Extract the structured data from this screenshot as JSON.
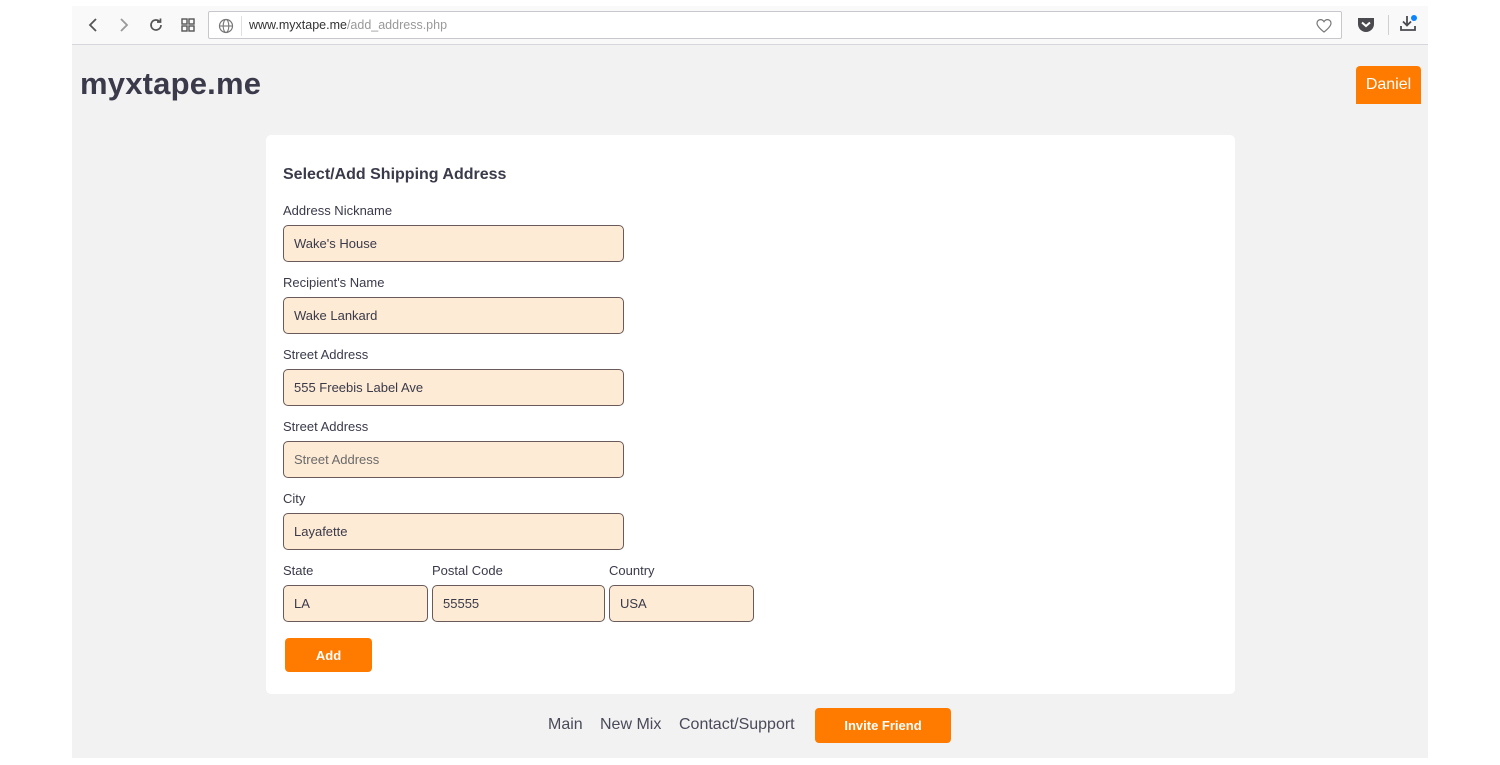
{
  "browser": {
    "url_domain": "www.myxtape.me",
    "url_path": "/add_address.php",
    "icons": {
      "back": "chevron-left-icon",
      "forward": "chevron-right-icon",
      "reload": "reload-icon",
      "speed_dial": "grid-icon",
      "site_info": "globe-icon",
      "bookmark": "heart-icon",
      "pocket": "pocket-icon",
      "download": "download-icon"
    }
  },
  "header": {
    "logo": "myxtape.me",
    "user_name": "Daniel"
  },
  "form": {
    "title": "Select/Add Shipping Address",
    "nickname": {
      "label": "Address Nickname",
      "value": "Wake's House",
      "placeholder": ""
    },
    "recipient": {
      "label": "Recipient's Name",
      "value": "Wake Lankard",
      "placeholder": ""
    },
    "street1": {
      "label": "Street Address",
      "value": "555 Freebis Label Ave",
      "placeholder": ""
    },
    "street2": {
      "label": "Street Address",
      "value": "",
      "placeholder": "Street Address"
    },
    "city": {
      "label": "City",
      "value": "Layafette",
      "placeholder": ""
    },
    "state": {
      "label": "State",
      "value": "LA",
      "placeholder": ""
    },
    "postal": {
      "label": "Postal Code",
      "value": "55555",
      "placeholder": ""
    },
    "country": {
      "label": "Country",
      "value": "USA",
      "placeholder": ""
    },
    "add_label": "Add"
  },
  "footer": {
    "links": [
      "Main",
      "New Mix",
      "Contact/Support"
    ],
    "invite_label": "Invite Friend"
  },
  "colors": {
    "accent": "#ff7b00",
    "input_bg": "#fdebd5",
    "page_bg": "#f2f2f2",
    "text": "#3a3a4a"
  }
}
